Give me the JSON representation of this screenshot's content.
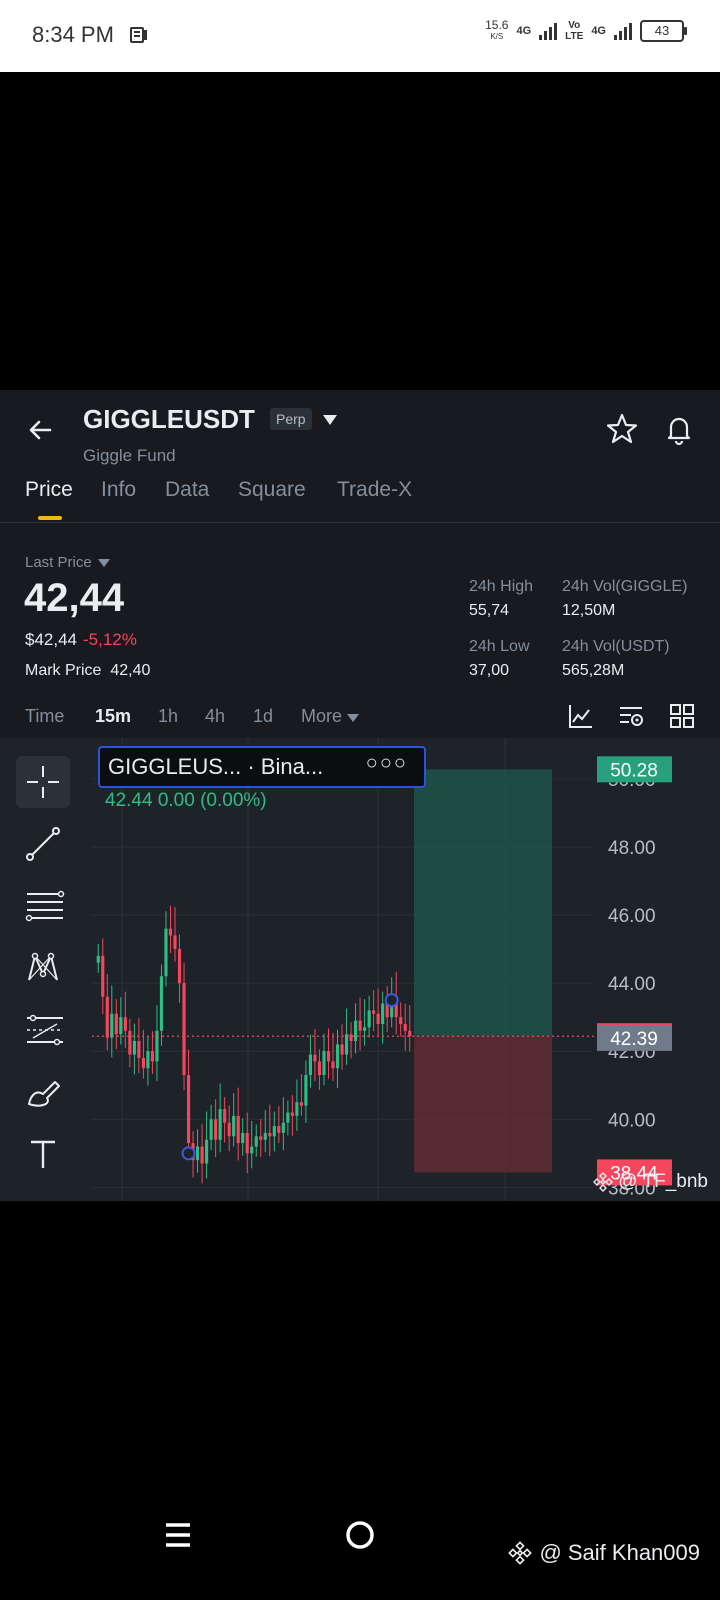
{
  "status_bar": {
    "time": "8:34 PM",
    "speed_value": "15.6",
    "speed_unit": "K/S",
    "net1": "4G",
    "net_volte": "Vo\nLTE",
    "net2": "4G",
    "battery": "43"
  },
  "header": {
    "symbol": "GIGGLEUSDT",
    "badge": "Perp",
    "subtitle": "Giggle Fund"
  },
  "tabs": [
    {
      "label": "Price",
      "active": true
    },
    {
      "label": "Info"
    },
    {
      "label": "Data"
    },
    {
      "label": "Square"
    },
    {
      "label": "Trade-X"
    }
  ],
  "ticker": {
    "last_price_label": "Last Price",
    "last_price": "42,44",
    "usd_price": "$42,44",
    "change_pct": "-5,12%",
    "mark_label": "Mark Price",
    "mark_price": "42,40",
    "high_label": "24h High",
    "high_value": "55,74",
    "low_label": "24h Low",
    "low_value": "37,00",
    "vol_base_label": "24h Vol(GIGGLE)",
    "vol_base_value": "12,50M",
    "vol_quote_label": "24h Vol(USDT)",
    "vol_quote_value": "565,28M"
  },
  "intervals": {
    "items": [
      "Time",
      "15m",
      "1h",
      "4h",
      "1d",
      "More"
    ],
    "active": "15m"
  },
  "chart": {
    "legend_name": "GIGGLEUS... · Bina...",
    "legend_dots": "○○○",
    "legend_ohlc": "42.44  0.00 (0.00%)",
    "watermark": "@ TF_bnb"
  },
  "chart_data": {
    "type": "candlestick",
    "interval": "15m",
    "y_ticks": [
      "50.00",
      "48.00",
      "46.00",
      "44.00",
      "42.00",
      "40.00",
      "38.00"
    ],
    "y_tick_values": [
      50,
      48,
      46,
      44,
      42,
      40,
      38
    ],
    "ylim": [
      37.6,
      51.2
    ],
    "price_tags": [
      {
        "label": "50.28",
        "value": 50.28,
        "color": "#26A17B"
      },
      {
        "label": "42.44",
        "value": 42.44,
        "color": "#F6465D"
      },
      {
        "label": "42.39",
        "value": 42.39,
        "color": "#707A8A"
      },
      {
        "label": "38.44",
        "value": 38.44,
        "color": "#F6465D"
      }
    ],
    "position_tool": {
      "entry": 42.44,
      "target": 50.28,
      "stop": 38.44
    },
    "last_price_line": 42.44,
    "closes": [
      44.8,
      43.6,
      42.4,
      43.1,
      42.5,
      43.0,
      42.6,
      41.9,
      42.3,
      41.8,
      41.5,
      42.0,
      41.7,
      42.6,
      44.2,
      45.6,
      45.4,
      45.0,
      44.0,
      41.3,
      39.3,
      38.8,
      39.2,
      38.7,
      39.4,
      40.0,
      39.4,
      40.3,
      39.9,
      39.5,
      40.1,
      39.3,
      39.6,
      39.0,
      39.2,
      39.5,
      39.4,
      39.6,
      39.5,
      39.8,
      39.6,
      39.9,
      40.2,
      40.1,
      40.5,
      40.4,
      41.3,
      41.9,
      41.7,
      41.3,
      42.0,
      41.7,
      41.5,
      42.2,
      41.9,
      42.5,
      42.3,
      42.9,
      42.6,
      42.7,
      43.2,
      43.1,
      42.8,
      43.4,
      43.0,
      43.5,
      43.0,
      42.8,
      42.6,
      42.44
    ]
  },
  "bottom": {
    "credit": "@ Saif Khan009"
  }
}
